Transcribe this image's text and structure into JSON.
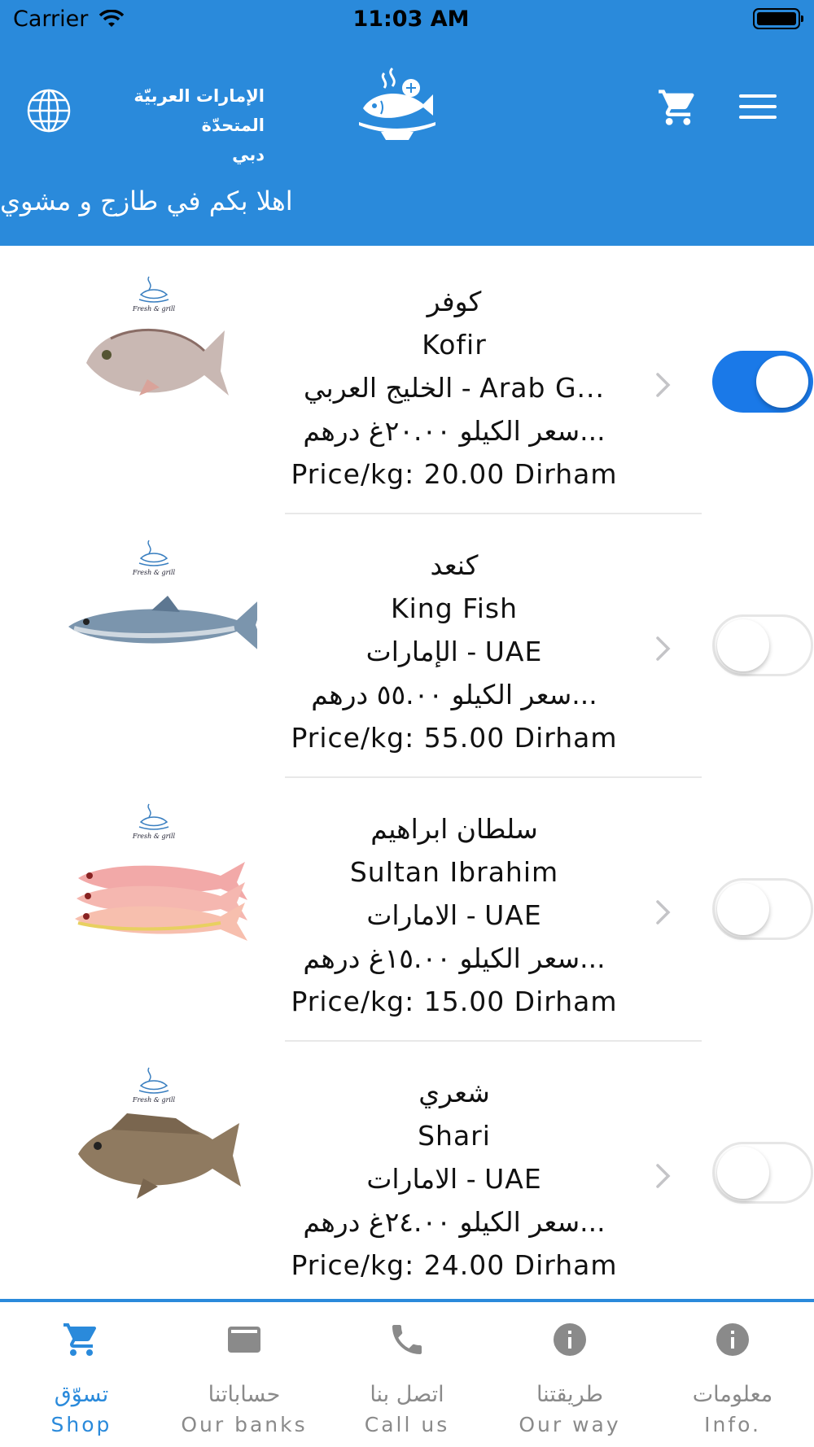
{
  "status_bar": {
    "carrier": "Carrier",
    "time": "11:03 AM"
  },
  "header": {
    "location_line1": "الإمارات العربيّة المتحدّة",
    "location_line2": "دبي",
    "welcome": "اهلا بكم في طازج و مشوي"
  },
  "colors": {
    "brand": "#2A8ADB",
    "toggle_on": "#1A79E8"
  },
  "products": [
    {
      "name_ar": "كوفر",
      "name_en": "Kofir",
      "origin": "الخليج العربي - Arab G...",
      "price_ar": "سعر الكيلو ٢٠.٠٠غ درهم...",
      "price_en": "Price/kg: 20.00 Dirham",
      "selected": true,
      "fish": "seabream"
    },
    {
      "name_ar": "كنعد",
      "name_en": "King Fish",
      "origin": "الإمارات - UAE",
      "price_ar": "سعر الكيلو ٥٥.٠٠ درهم...",
      "price_en": "Price/kg: 55.00 Dirham",
      "selected": false,
      "fish": "kingfish"
    },
    {
      "name_ar": "سلطان ابراهيم",
      "name_en": "Sultan Ibrahim",
      "origin": "الامارات - UAE",
      "price_ar": "سعر الكيلو ١٥.٠٠غ درهم...",
      "price_en": "Price/kg: 15.00 Dirham",
      "selected": false,
      "fish": "redmullet"
    },
    {
      "name_ar": "شعري",
      "name_en": "Shari",
      "origin": "الامارات - UAE",
      "price_ar": "سعر الكيلو ٢٤.٠٠غ درهم...",
      "price_en": "Price/kg: 24.00 Dirham",
      "selected": false,
      "fish": "emperor"
    }
  ],
  "tabs": [
    {
      "ar": "تسوّق",
      "en": "Shop",
      "icon": "cart-icon",
      "active": true
    },
    {
      "ar": "حساباتنا",
      "en": "Our banks",
      "icon": "card-icon",
      "active": false
    },
    {
      "ar": "اتصل بنا",
      "en": "Call us",
      "icon": "phone-icon",
      "active": false
    },
    {
      "ar": "طريقتنا",
      "en": "Our way",
      "icon": "info-icon",
      "active": false
    },
    {
      "ar": "معلومات",
      "en": "Info.",
      "icon": "info-icon",
      "active": false
    }
  ]
}
